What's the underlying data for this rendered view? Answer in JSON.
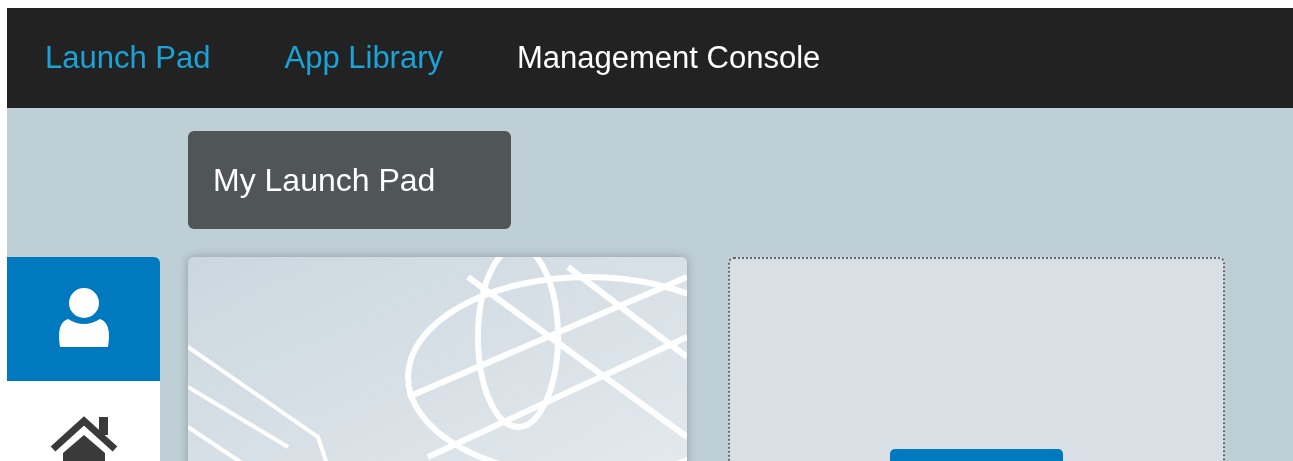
{
  "nav": [
    {
      "label": "Launch Pad",
      "selected": false
    },
    {
      "label": "App Library",
      "selected": false
    },
    {
      "label": "Management Console",
      "selected": true
    }
  ],
  "page_title": "My Launch Pad",
  "sidebar": {
    "items": [
      {
        "kind": "user",
        "selected": true
      },
      {
        "kind": "home",
        "selected": false
      }
    ]
  }
}
